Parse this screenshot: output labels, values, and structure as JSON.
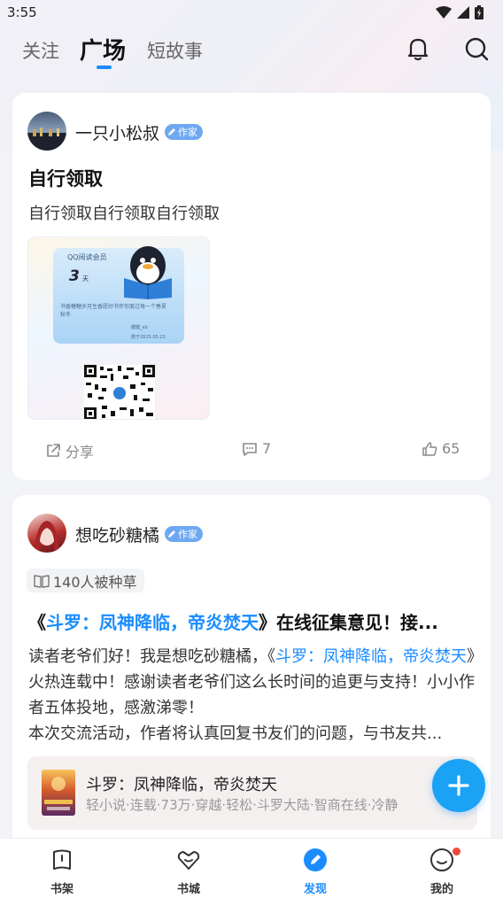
{
  "status_bar": {
    "time": "3:55"
  },
  "header": {
    "tabs": [
      {
        "label": "关注",
        "active": false
      },
      {
        "label": "广场",
        "active": true
      },
      {
        "label": "短故事",
        "active": false
      }
    ],
    "icons": [
      "bell-icon",
      "search-icon"
    ]
  },
  "posts": [
    {
      "author": "一只小松叔",
      "badge": "作家",
      "title": "自行领取",
      "text": "自行领取自行领取自行领取",
      "promo": {
        "brand": "QQ阅读会员",
        "days": "3",
        "days_unit": "天",
        "message": "书香糖糖岁月生香愿好书伴你度过每一个春夏秋冬",
        "user": "糖糖_ab",
        "date": "赠于2025.05.23"
      },
      "share_label": "分享",
      "comments": "7",
      "likes": "65"
    },
    {
      "author": "想吃砂糖橘",
      "badge": "作家",
      "tag": "140人被种草",
      "title_prefix": "《",
      "title_book": "斗罗：凤神降临，帝炎焚天",
      "title_suffix": "》在线征集意见！接...",
      "body_1": "读者老爷们好！我是想吃砂糖橘，《",
      "body_book": "斗罗：凤神降临，帝炎焚天",
      "body_2": "》火热连载中！感谢读者老爷们这么长时间的追更与支持！小小作者五体投地，感激涕零！",
      "body_3": "本次交流活动，作者将认真回复书友们的问题，与书友共...",
      "book": {
        "name": "斗罗：凤神降临，帝炎焚天",
        "meta": "轻小说·连载·73万·穿越·轻松·斗罗大陆·智商在线·冷静"
      }
    }
  ],
  "bottom_nav": [
    {
      "label": "书架",
      "active": false
    },
    {
      "label": "书城",
      "active": false
    },
    {
      "label": "发现",
      "active": true
    },
    {
      "label": "我的",
      "active": false
    }
  ],
  "colors": {
    "accent": "#1a8cff",
    "badge": "#6ea8f2",
    "fab": "#1aa2f5"
  }
}
